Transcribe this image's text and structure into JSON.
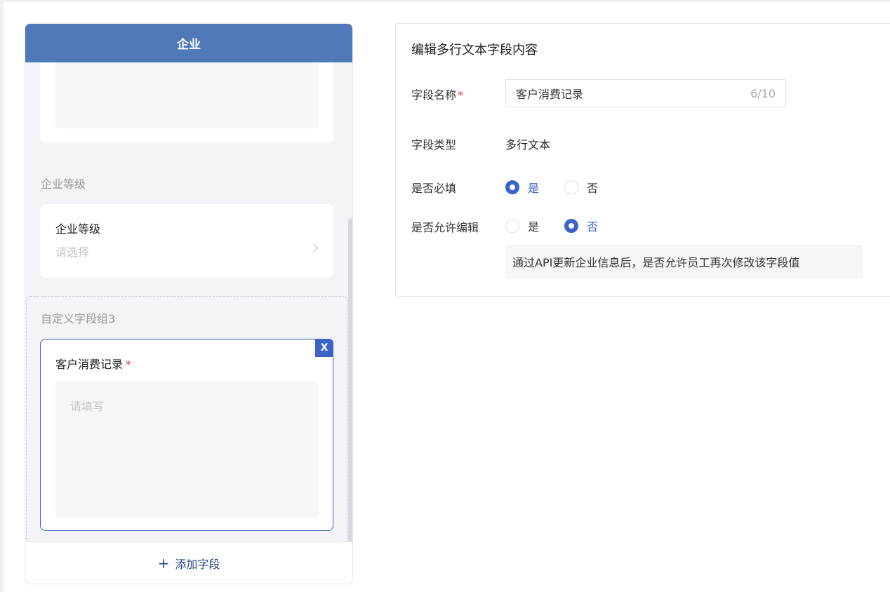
{
  "preview": {
    "header_title": "企业",
    "groups": [
      {
        "title": "企业等级",
        "field_label": "企业等级",
        "field_placeholder": "请选择"
      },
      {
        "title": "自定义字段组3",
        "field_label": "客户消费记录",
        "required_mark": "*",
        "field_placeholder": "请填写",
        "close_label": "X"
      }
    ],
    "add_field": {
      "icon": "+",
      "label": "添加字段"
    }
  },
  "editor": {
    "title": "编辑多行文本字段内容",
    "name": {
      "label": "字段名称",
      "required_mark": "*",
      "value": "客户消费记录",
      "counter": "6/10"
    },
    "type": {
      "label": "字段类型",
      "value": "多行文本"
    },
    "required": {
      "label": "是否必填",
      "options": [
        {
          "label": "是",
          "checked": true
        },
        {
          "label": "否",
          "checked": false
        }
      ]
    },
    "editable": {
      "label": "是否允许编辑",
      "options": [
        {
          "label": "是",
          "checked": false
        },
        {
          "label": "否",
          "checked": true
        }
      ],
      "hint": "通过API更新企业信息后，是否允许员工再次修改该字段值"
    }
  },
  "colors": {
    "header": "#4f79b9",
    "accent": "#3b64c9",
    "required": "#e03a3a"
  }
}
